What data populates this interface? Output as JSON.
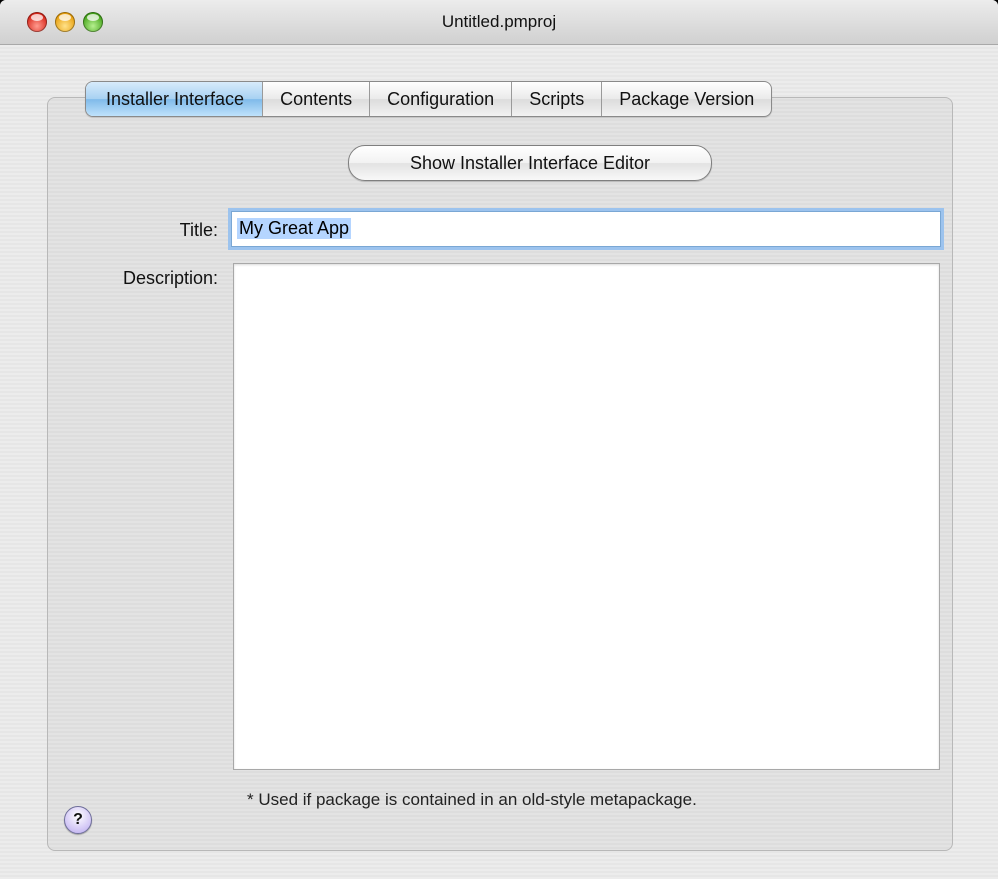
{
  "window": {
    "title": "Untitled.pmproj"
  },
  "tabs": [
    {
      "label": "Installer Interface",
      "active": true
    },
    {
      "label": "Contents",
      "active": false
    },
    {
      "label": "Configuration",
      "active": false
    },
    {
      "label": "Scripts",
      "active": false
    },
    {
      "label": "Package Version",
      "active": false
    }
  ],
  "editor_button": {
    "label": "Show Installer Interface Editor"
  },
  "form": {
    "title_label": "Title:",
    "title_value": "My Great App",
    "description_label": "Description:",
    "description_value": ""
  },
  "footnote": "* Used if package is contained in an old-style metapackage.",
  "help": {
    "label": "?"
  },
  "icons": {
    "close": "close-icon",
    "minimize": "minimize-icon",
    "zoom": "zoom-icon",
    "help": "help-icon"
  },
  "colors": {
    "active_tab": "#a7d1f2",
    "focus_ring": "#9cc3ee",
    "selection": "#b5d5ff",
    "close_light": "#d8261a",
    "minimize_light": "#e79e0c",
    "zoom_light": "#44a31a",
    "help_button": "#d9cff7"
  }
}
